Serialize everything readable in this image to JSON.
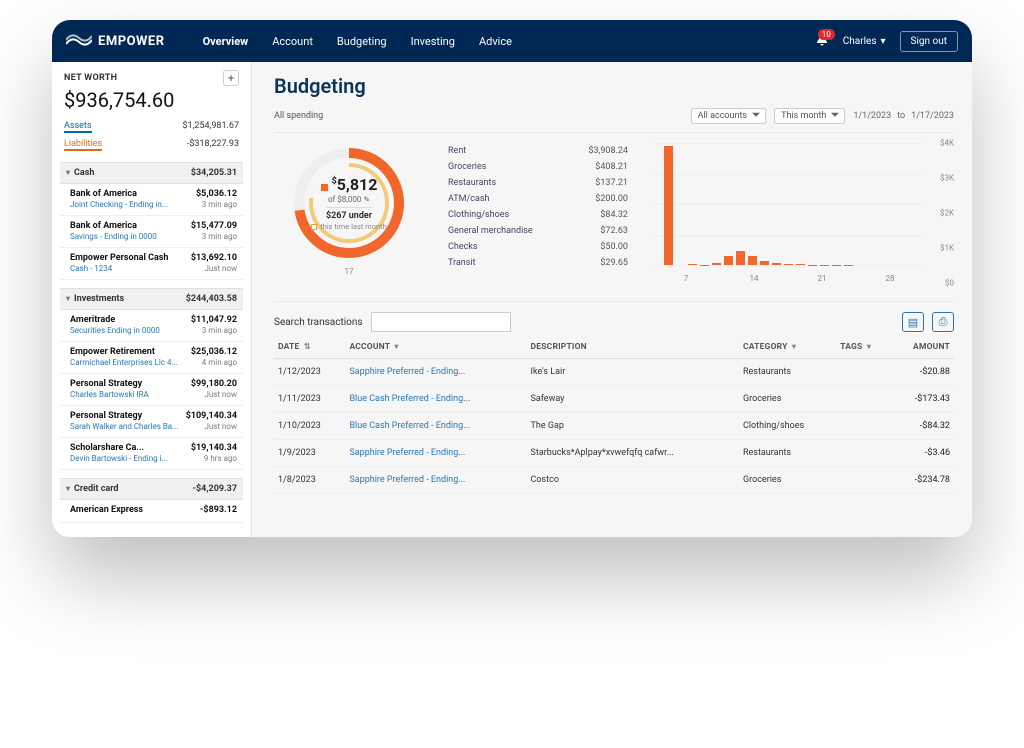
{
  "nav": {
    "brand": "EMPOWER",
    "links": [
      "Overview",
      "Account",
      "Budgeting",
      "Investing",
      "Advice"
    ],
    "active": 0,
    "notif_count": "10",
    "user": "Charles",
    "signout": "Sign out"
  },
  "sidebar": {
    "nw_label": "NET WORTH",
    "nw_value": "$936,754.60",
    "assets_label": "Assets",
    "assets_value": "$1,254,981.67",
    "liab_label": "Liabilities",
    "liab_value": "-$318,227.93",
    "sections": [
      {
        "name": "Cash",
        "total": "$34,205.31",
        "accounts": [
          {
            "name": "Bank of America",
            "sub": "Joint Checking - Ending in...",
            "amount": "$5,036.12",
            "time": "3 min ago"
          },
          {
            "name": "Bank of America",
            "sub": "Savings - Ending in 0000",
            "amount": "$15,477.09",
            "time": "3 min ago"
          },
          {
            "name": "Empower Personal Cash",
            "sub": "Cash - 1234",
            "amount": "$13,692.10",
            "time": "Just now"
          }
        ]
      },
      {
        "name": "Investments",
        "total": "$244,403.58",
        "accounts": [
          {
            "name": "Ameritrade",
            "sub": "Securities Ending in 0000",
            "amount": "$11,047.92",
            "time": "3 min ago"
          },
          {
            "name": "Empower Retirement",
            "sub": "Carmichael Enterprises Llc 4...",
            "amount": "$25,036.12",
            "time": "4 min ago"
          },
          {
            "name": "Personal Strategy",
            "sub": "Charles Bartowski IRA",
            "amount": "$99,180.20",
            "time": "Just now"
          },
          {
            "name": "Personal Strategy",
            "sub": "Sarah Walker and Charles Ba...",
            "amount": "$109,140.34",
            "time": "Just now"
          },
          {
            "name": "Scholarshare Ca...",
            "sub": "Devin Bartowski - Ending i...",
            "amount": "$19,140.34",
            "time": "9 hrs ago"
          }
        ]
      },
      {
        "name": "Credit card",
        "total": "-$4,209.37",
        "accounts": [
          {
            "name": "American Express",
            "sub": "",
            "amount": "-$893.12",
            "time": ""
          }
        ]
      }
    ]
  },
  "page_title": "Budgeting",
  "subheader": "All spending",
  "filters": {
    "accounts": "All accounts",
    "period": "This month",
    "from": "1/1/2023",
    "to_word": "to",
    "to": "1/17/2023"
  },
  "donut": {
    "value": "5,812",
    "prefix": "$",
    "of": "of $8,000",
    "under": "$267 under",
    "legend": "this time last month",
    "bottom_label": "17"
  },
  "categories": [
    {
      "name": "Rent",
      "amount": "$3,908.24"
    },
    {
      "name": "Groceries",
      "amount": "$408.21"
    },
    {
      "name": "Restaurants",
      "amount": "$137.21"
    },
    {
      "name": "ATM/cash",
      "amount": "$200.00"
    },
    {
      "name": "Clothing/shoes",
      "amount": "$84.32"
    },
    {
      "name": "General merchandise",
      "amount": "$72.63"
    },
    {
      "name": "Checks",
      "amount": "$50.00"
    },
    {
      "name": "Transit",
      "amount": "$29.65"
    }
  ],
  "chart_data": {
    "type": "bar",
    "x": [
      1,
      2,
      3,
      4,
      5,
      6,
      7,
      8,
      9,
      10,
      11,
      12,
      13,
      14,
      15,
      16,
      17
    ],
    "values": [
      0,
      3900,
      0,
      20,
      10,
      80,
      300,
      450,
      280,
      120,
      60,
      30,
      20,
      10,
      5,
      5,
      3
    ],
    "ylim": [
      0,
      4000
    ],
    "yticks": [
      "$0",
      "$1K",
      "$2K",
      "$3K",
      "$4K"
    ],
    "xticks": [
      "7",
      "14",
      "21",
      "28"
    ]
  },
  "tx_search_label": "Search transactions",
  "tx_headers": {
    "date": "DATE",
    "account": "ACCOUNT",
    "desc": "DESCRIPTION",
    "category": "CATEGORY",
    "tags": "TAGS",
    "amount": "AMOUNT"
  },
  "transactions": [
    {
      "date": "1/12/2023",
      "account": "Sapphire Preferred - Ending...",
      "desc": "Ike's Lair",
      "category": "Restaurants",
      "amount": "-$20.88"
    },
    {
      "date": "1/11/2023",
      "account": "Blue Cash Preferred - Ending...",
      "desc": "Safeway",
      "category": "Groceries",
      "amount": "-$173.43"
    },
    {
      "date": "1/10/2023",
      "account": "Blue Cash Preferred - Ending...",
      "desc": "The Gap",
      "category": "Clothing/shoes",
      "amount": "-$84.32"
    },
    {
      "date": "1/9/2023",
      "account": "Sapphire Preferred - Ending...",
      "desc": "Starbucks*Aplpay*xvwefqfq cafwr...",
      "category": "Restaurants",
      "amount": "-$3.46"
    },
    {
      "date": "1/8/2023",
      "account": "Sapphire Preferred - Ending...",
      "desc": "Costco",
      "category": "Groceries",
      "amount": "-$234.78"
    }
  ]
}
